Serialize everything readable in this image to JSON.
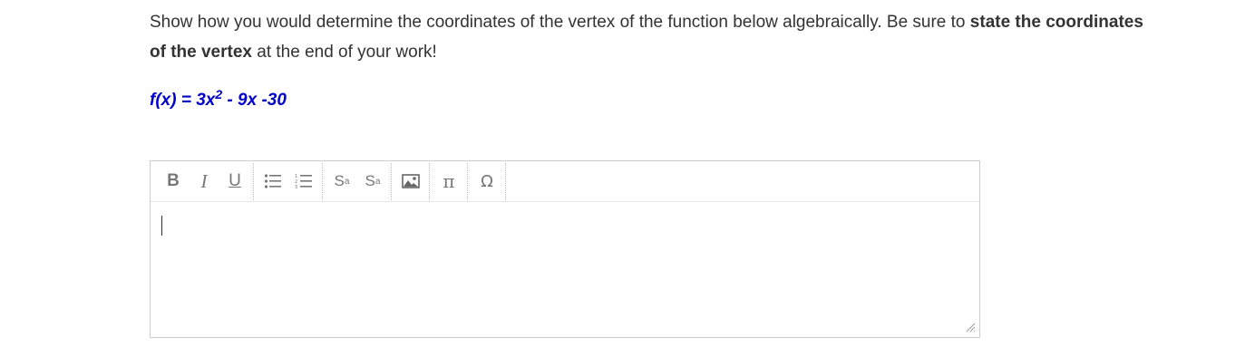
{
  "question": {
    "text_part1": "Show how you would determine the coordinates of the vertex of the function below algebraically.  Be sure to ",
    "bold_part": "state the coordinates of the vertex",
    "text_part2": " at the end of your work!"
  },
  "formula": {
    "prefix": "f(x) = 3x",
    "exponent": "2",
    "suffix": " - 9x -30",
    "color": "#0000cc"
  },
  "toolbar": {
    "bold_label": "B",
    "italic_label": "I",
    "underline_label": "U",
    "superscript_base": "S",
    "superscript_mark": "a",
    "subscript_base": "S",
    "subscript_mark": "a",
    "pi_label": "π",
    "omega_label": "Ω",
    "icons": [
      "bulleted-list-icon",
      "numbered-list-icon",
      "image-icon"
    ]
  },
  "editor": {
    "value": ""
  }
}
